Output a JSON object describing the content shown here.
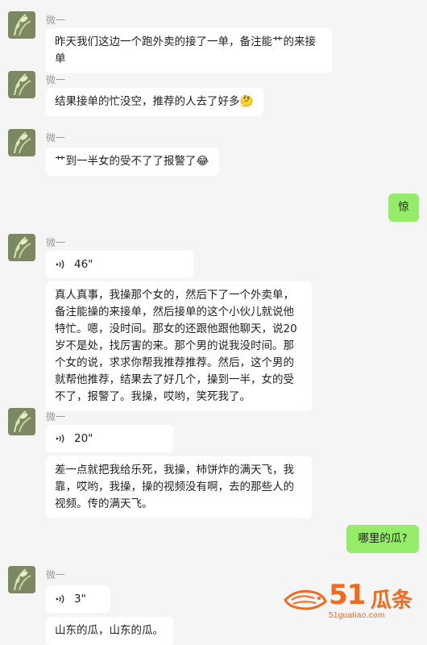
{
  "sender_name": "微一",
  "messages": [
    {
      "type": "text",
      "text": "昨天我们这边一个跑外卖的接了一单，备注能艹的来接单"
    },
    {
      "type": "text",
      "text": "结果接单的忙没空，推荐的人去了好多🤔"
    },
    {
      "type": "text",
      "text": "艹到一半女的受不了了报警了😂"
    },
    {
      "type": "text_self",
      "text": "惊"
    },
    {
      "type": "voice",
      "duration": "46\""
    },
    {
      "type": "text",
      "text": "真人真事，我操那个女的，然后下了一个外卖单，备注能操的来接单，然后接单的这个小伙儿就说他特忙。嗯，没时间。那女的还跟他跟他聊天，说20岁不是处，找厉害的来。那个男的说我没时间。那个女的说，求求你帮我推荐推荐。然后，这个男的就帮他推荐，结果去了好几个，操到一半，女的受不了，报警了。我操，哎哟，笑死我了。"
    },
    {
      "type": "voice",
      "duration": "20\""
    },
    {
      "type": "text",
      "text": "差一点就把我给乐死，我操，柿饼炸的满天飞，我靠，哎哟，我操，操的视频没有啊，去的那些人的视频。传的满天飞。"
    },
    {
      "type": "text_self",
      "text": "哪里的瓜?"
    },
    {
      "type": "voice",
      "duration": "3\""
    },
    {
      "type": "text",
      "text": "山东的瓜，山东的瓜。"
    }
  ],
  "watermark": {
    "number": "51",
    "chinese": "瓜条",
    "url": "51guatiao.com"
  },
  "colors": {
    "self_bubble": "#95ec69",
    "other_bubble": "#ffffff",
    "background": "#f5f5f5",
    "brand": "#f26a1b"
  }
}
